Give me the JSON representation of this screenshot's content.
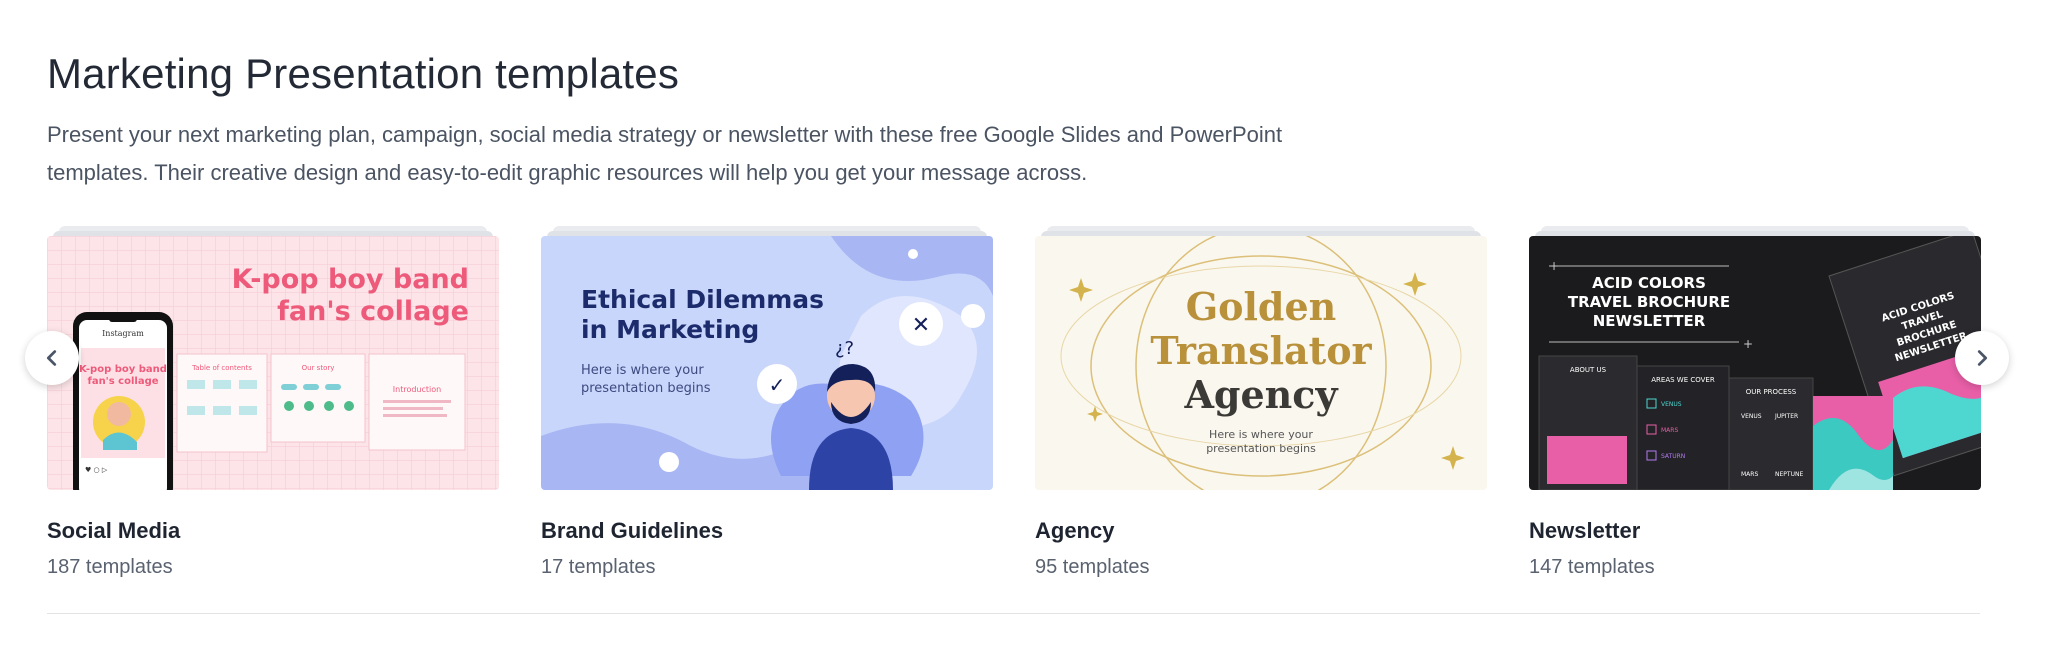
{
  "header": {
    "title": "Marketing Presentation templates",
    "description": "Present your next marketing plan, campaign, social media strategy or newsletter with these free Google Slides and PowerPoint templates. Their creative design and easy-to-edit graphic resources will help you get your message across."
  },
  "carousel": {
    "prev_icon": "chevron-left-icon",
    "next_icon": "chevron-right-icon",
    "cards": [
      {
        "title": "Social Media",
        "count": "187 templates",
        "thumb": {
          "heading_line1": "K-pop boy band",
          "heading_line2": "fan's collage",
          "phone_app": "Instagram",
          "phone_heading_line1": "K-pop boy band",
          "phone_heading_line2": "fan's collage",
          "slide1_title": "Table of contents",
          "slide2_title": "Our story",
          "slide3_title": "Introduction",
          "colors": {
            "bg": "#fce4e8",
            "accent": "#ee5a7a"
          }
        }
      },
      {
        "title": "Brand Guidelines",
        "count": "17 templates",
        "thumb": {
          "heading_line1": "Ethical Dilemmas",
          "heading_line2": "in Marketing",
          "sub_line1": "Here is where your",
          "sub_line2": "presentation begins",
          "colors": {
            "bg": "#c9d6fb",
            "accent": "#1c2b6b"
          }
        }
      },
      {
        "title": "Agency",
        "count": "95 templates",
        "thumb": {
          "heading_line1": "Golden",
          "heading_line2": "Translator",
          "heading_line3": "Agency",
          "sub_line1": "Here is where your",
          "sub_line2": "presentation begins",
          "colors": {
            "bg": "#faf7ee",
            "accent": "#b8913a"
          }
        }
      },
      {
        "title": "Newsletter",
        "count": "147 templates",
        "thumb": {
          "heading_line1": "ACID COLORS",
          "heading_line2": "TRAVEL BROCHURE",
          "heading_line3": "NEWSLETTER",
          "side_line1": "ACID COLORS",
          "side_line2": "TRAVEL",
          "side_line3": "BROCHURE",
          "side_line4": "NEWSLETTER",
          "label_about": "ABOUT US",
          "label_areas": "AREAS WE COVER",
          "label_process": "OUR PROCESS",
          "label_venus": "VENUS",
          "label_mars": "MARS",
          "label_saturn": "SATURN",
          "label_jupiter": "JUPITER",
          "label_neptune": "NEPTUNE",
          "colors": {
            "bg": "#1b1b1d",
            "accent": "#f06ab0"
          }
        }
      }
    ]
  }
}
